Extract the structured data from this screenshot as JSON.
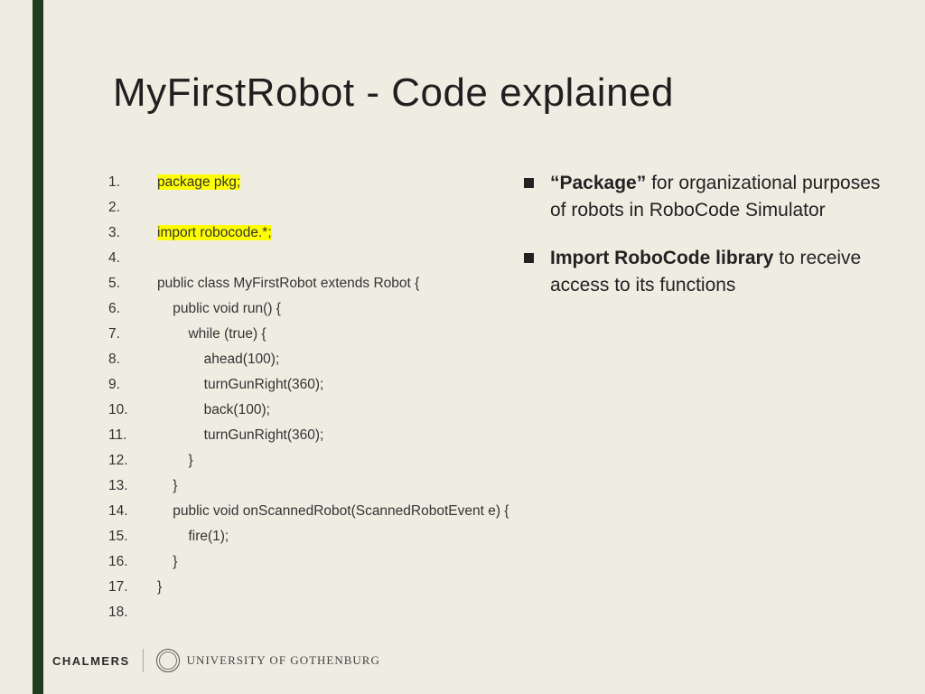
{
  "title": "MyFirstRobot - Code explained",
  "code": [
    {
      "n": "1.",
      "text": "package pkg;",
      "hl": true
    },
    {
      "n": "2.",
      "text": "",
      "hl": false
    },
    {
      "n": "3.",
      "text": "import robocode.*;",
      "hl": true
    },
    {
      "n": "4.",
      "text": "",
      "hl": false
    },
    {
      "n": "5.",
      "text": "public class MyFirstRobot extends Robot {",
      "hl": false
    },
    {
      "n": "6.",
      "text": "    public void run() {",
      "hl": false
    },
    {
      "n": "7.",
      "text": "        while (true) {",
      "hl": false
    },
    {
      "n": "8.",
      "text": "            ahead(100);",
      "hl": false
    },
    {
      "n": "9.",
      "text": "            turnGunRight(360);",
      "hl": false
    },
    {
      "n": "10.",
      "text": "            back(100);",
      "hl": false
    },
    {
      "n": "11.",
      "text": "            turnGunRight(360);",
      "hl": false
    },
    {
      "n": "12.",
      "text": "        }",
      "hl": false
    },
    {
      "n": "13.",
      "text": "    }",
      "hl": false
    },
    {
      "n": "14.",
      "text": "    public void onScannedRobot(ScannedRobotEvent e) {",
      "hl": false
    },
    {
      "n": "15.",
      "text": "        fire(1);",
      "hl": false
    },
    {
      "n": "16.",
      "text": "    }",
      "hl": false
    },
    {
      "n": "17.",
      "text": "}",
      "hl": false
    },
    {
      "n": "18.",
      "text": "",
      "hl": false
    }
  ],
  "bullets": [
    {
      "strong": "“Package”",
      "rest": " for organizational purposes of robots in RoboCode Simulator"
    },
    {
      "strong": "Import RoboCode library",
      "rest": " to receive access to its functions"
    }
  ],
  "footer": {
    "chalmers": "CHALMERS",
    "gu": "UNIVERSITY OF GOTHENBURG"
  }
}
